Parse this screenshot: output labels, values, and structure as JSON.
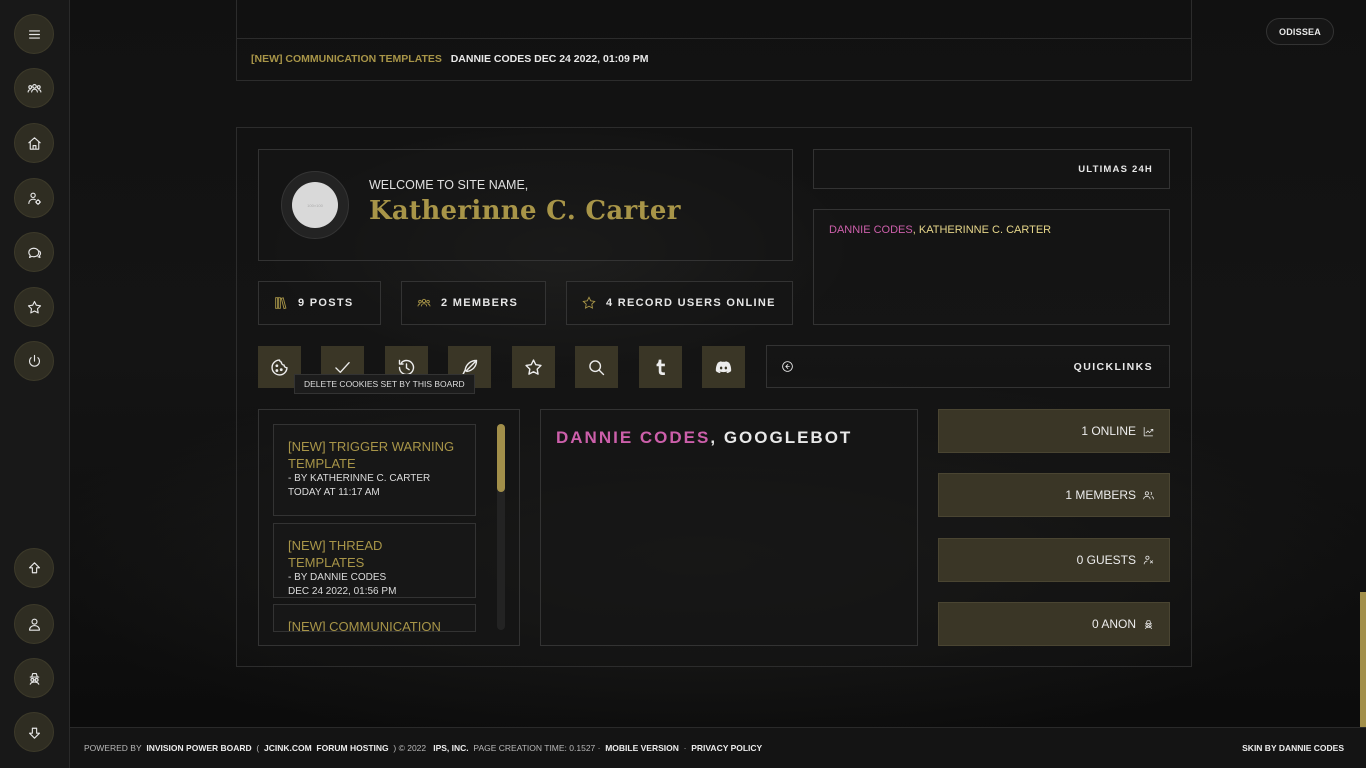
{
  "sidebar": {
    "top_items": [
      {
        "icon": "menu-icon"
      },
      {
        "icon": "members-icon"
      },
      {
        "icon": "home-icon"
      },
      {
        "icon": "user-settings-icon"
      },
      {
        "icon": "chat-icon"
      },
      {
        "icon": "star-icon"
      },
      {
        "icon": "power-icon"
      }
    ],
    "bottom_items": [
      {
        "icon": "arrow-up-icon"
      },
      {
        "icon": "user-icon"
      },
      {
        "icon": "spy-icon"
      },
      {
        "icon": "arrow-down-icon"
      }
    ]
  },
  "top_pill": "ODISSEA",
  "latest_topic": {
    "title": "[NEW] COMMUNICATION TEMPLATES",
    "meta": "DANNIE CODES DEC 24 2022, 01:09 PM"
  },
  "welcome": {
    "greeting": "WELCOME TO SITE NAME,",
    "username": "Katherinne C. Carter",
    "avatar_text": "100×100"
  },
  "stats": {
    "posts": "9 POSTS",
    "members": "2 MEMBERS",
    "record": "4 RECORD USERS ONLINE"
  },
  "ultimas": {
    "title": "ULTIMAS 24H",
    "user1": "DANNIE CODES",
    "separator": ", ",
    "user2": "KATHERINNE C. CARTER"
  },
  "toolbar": {
    "icons": [
      "cookie-icon",
      "check-icon",
      "history-icon",
      "feather-icon",
      "star-icon",
      "search-icon",
      "tumblr-icon",
      "discord-icon"
    ],
    "tooltip": "DELETE COOKIES SET BY THIS BOARD"
  },
  "quicklinks": {
    "label": "QUICKLINKS"
  },
  "recent_topics": [
    {
      "title": "[NEW] TRIGGER WARNING TEMPLATE",
      "by": "- BY KATHERINNE C. CARTER",
      "date": "TODAY AT 11:17 AM"
    },
    {
      "title": "[NEW] THREAD TEMPLATES",
      "by": "- BY DANNIE CODES",
      "date": "DEC 24 2022, 01:56 PM"
    },
    {
      "title": "[NEW] COMMUNICATION",
      "by": "",
      "date": ""
    }
  ],
  "online_users": {
    "user1": "DANNIE CODES",
    "separator": ", ",
    "user2": "GOOGLEBOT"
  },
  "online_stats": {
    "online": "1 ONLINE",
    "members": "1 MEMBERS",
    "guests": "0 GUESTS",
    "anon": "0 ANON"
  },
  "footer": {
    "powered_by": "POWERED BY",
    "ipb": "INVISION POWER BOARD",
    "paren_open": "(",
    "jcink": "JCINK.COM",
    "hosting": "FORUM HOSTING",
    "paren_close": ") © 2022",
    "ips": "IPS, INC.",
    "page_time": "PAGE CREATION TIME: 0.1527 ·",
    "mobile": "MOBILE VERSION",
    "dot": "·",
    "privacy": "PRIVACY POLICY",
    "skin": "SKIN BY DANNIE CODES"
  },
  "colors": {
    "gold": "#a89548",
    "pink": "#cc5faa",
    "yellow": "#e6d68a",
    "button_bg": "#3a3626"
  }
}
